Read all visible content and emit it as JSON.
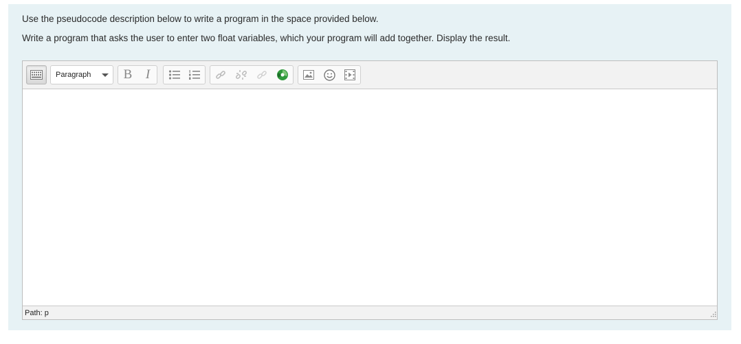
{
  "instructions": {
    "line1": "Use the pseudocode description below to write a program in the space provided below.",
    "line2": "Write a program that asks the user to enter two float variables, which your program will add together.  Display the result."
  },
  "editor": {
    "format_select": "Paragraph",
    "content": "",
    "status_path": "Path: p",
    "toolbar": {
      "icons": [
        "keyboard-icon",
        "bold-icon",
        "italic-icon",
        "bullet-list-icon",
        "numbered-list-icon",
        "link-icon",
        "unlink-icon",
        "anchor-icon",
        "media-plugin-icon",
        "image-icon",
        "emoticon-icon",
        "media-icon"
      ],
      "bold_glyph": "B",
      "italic_glyph": "I"
    }
  },
  "colors": {
    "panel_bg": "#e7f2f5",
    "toolbar_bg": "#f2f2f2",
    "border": "#bdbdbd",
    "plugin_green": "#2f9a3c"
  }
}
